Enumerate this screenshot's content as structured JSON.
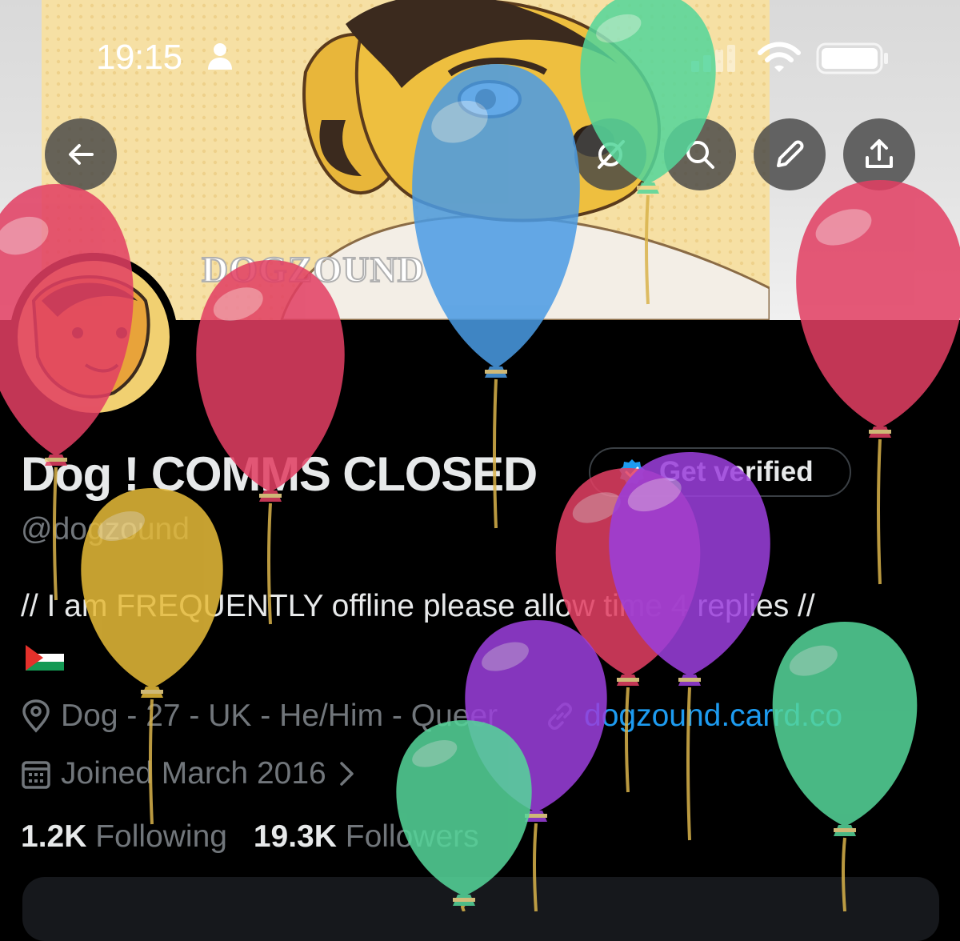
{
  "status_bar": {
    "time": "19:15",
    "icons": [
      "person-icon",
      "signal-icon",
      "wifi-icon",
      "battery-icon"
    ]
  },
  "banner": {
    "watermark": "DOGZOUND",
    "buttons": [
      "back-arrow-icon",
      "grok-icon",
      "search-icon",
      "pencil-icon",
      "share-icon"
    ]
  },
  "profile": {
    "display_name": "Dog ! COMMS CLOSED",
    "verify_label": "Get verified",
    "handle": "@dogzound",
    "bio": "// I am FREQUENTLY offline please allow time 4 replies //",
    "flag": "palestine-flag-icon",
    "location": "Dog - 27 - UK - He/Him - Queer",
    "link": "dogzound.carrd.co",
    "joined": "Joined March 2016",
    "following_count": "1.2K",
    "following_label": "Following",
    "followers_count": "19.3K",
    "followers_label": "Followers"
  },
  "colors": {
    "accent_blue": "#1d9bf0",
    "muted_text": "#71767b",
    "primary_text": "#e7e9ea",
    "balloon_red": "#e23f63",
    "balloon_blue": "#4a9be4",
    "balloon_green": "#55d69a",
    "balloon_yellow": "#e6bb39",
    "balloon_purple": "#9b3fdc"
  }
}
